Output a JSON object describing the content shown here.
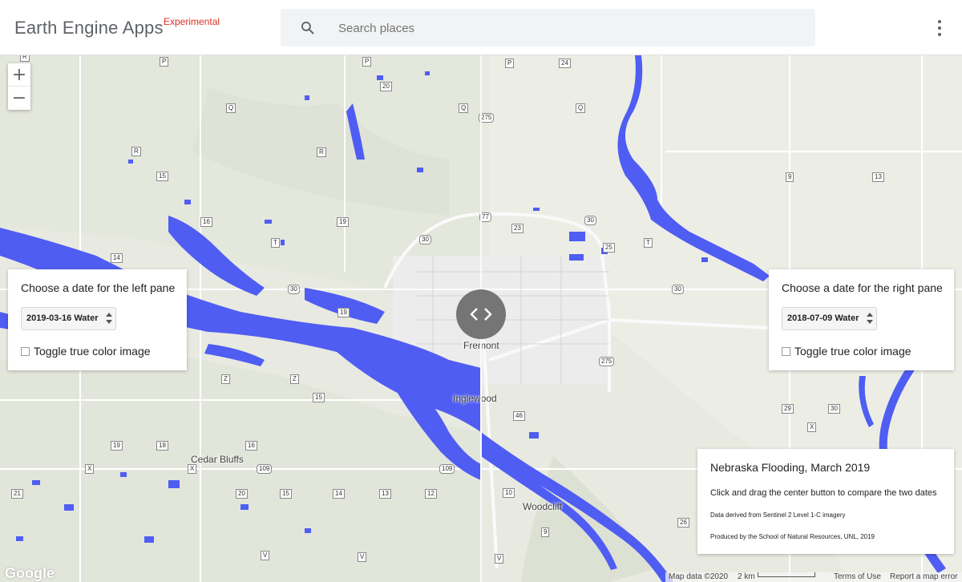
{
  "header": {
    "brand": "Earth Engine Apps",
    "tag": "Experimental",
    "search_placeholder": "Search places"
  },
  "zoom": {
    "in": "+",
    "out": "−"
  },
  "left_panel": {
    "title": "Choose a date for the left pane",
    "selected": "2019-03-16 Water",
    "checkbox_label": "Toggle true color image"
  },
  "right_panel": {
    "title": "Choose a date for the right pane",
    "selected": "2018-07-09 Water",
    "checkbox_label": "Toggle true color image"
  },
  "info": {
    "title": "Nebraska Flooding, March 2019",
    "subtitle": "Click and drag the center button to compare the two dates",
    "source": "Data derived from Sentinel 2 Level 1-C imagery",
    "credit": "Produced by the School of Natural Resources, UNL, 2019"
  },
  "map": {
    "places": {
      "fremont": "Fremont",
      "inglewood": "Inglewood",
      "cedar_bluffs": "Cedar Bluffs",
      "woodcliff": "Woodcliff"
    },
    "google": "Google",
    "map_data": "Map data ©2020",
    "scale": "2 km",
    "terms": "Terms of Use",
    "report": "Report a map error"
  },
  "colors": {
    "water": "#4f5df2",
    "land": "#e8eae1",
    "road": "#ffffff",
    "accent": "#d93025"
  }
}
